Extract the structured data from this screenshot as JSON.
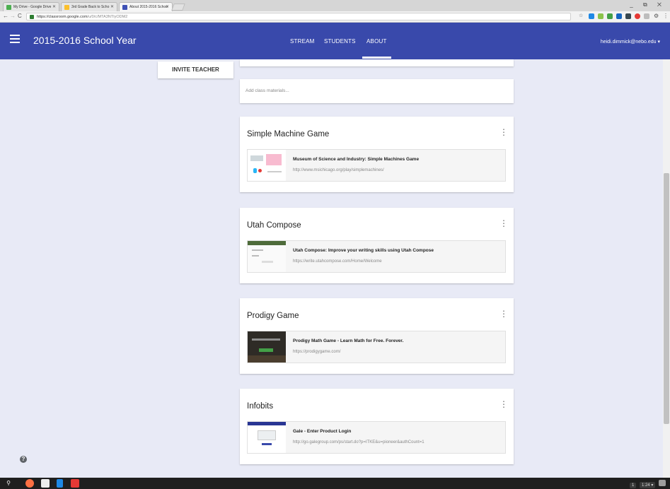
{
  "browser": {
    "tabs": [
      {
        "title": "My Drive - Google Drive",
        "color": "#4caf50"
      },
      {
        "title": "3rd Grade Back to Scho",
        "color": "#fbc02d"
      },
      {
        "title": "About 2015-2016 Schoo",
        "color": "#3f51b5"
      }
    ],
    "url_host": "https://classroom.google.com",
    "url_path": "/u/0/c/MTA3NTIyODM2",
    "window_controls": "_ ⧉ ✕"
  },
  "appbar": {
    "title": "2015-2016 School Year",
    "tabs": [
      "STREAM",
      "STUDENTS",
      "ABOUT"
    ],
    "active_tab": "ABOUT",
    "user": "heidi.dimmick@nebo.edu ▾",
    "color": "#3949ab"
  },
  "side": {
    "invite_label": "INVITE TEACHER",
    "help_glyph": "?"
  },
  "main": {
    "add_materials_placeholder": "Add class materials...",
    "topics": [
      {
        "title": "Simple Machine Game",
        "link_title": "Museum of Science and Industry: Simple Machines Game",
        "link_url": "http://www.msichicago.org/play/simplemachines/"
      },
      {
        "title": "Utah Compose",
        "link_title": "Utah Compose: Improve your writing skills using Utah Compose",
        "link_url": "https://write.utahcompose.com/Home/Welcome"
      },
      {
        "title": "Prodigy Game",
        "link_title": "Prodigy Math Game - Learn Math for Free. Forever.",
        "link_url": "https://prodigygame.com/"
      },
      {
        "title": "Infobits",
        "link_title": "Gale - Enter Product Login",
        "link_url": "http://go.galegroup.com/ps/start.do?p=ITKE&u=pioneer&authCount=1"
      }
    ],
    "more_glyph": "⋮"
  },
  "taskbar": {
    "status_items": [
      "1",
      "1:24 ▾"
    ]
  }
}
